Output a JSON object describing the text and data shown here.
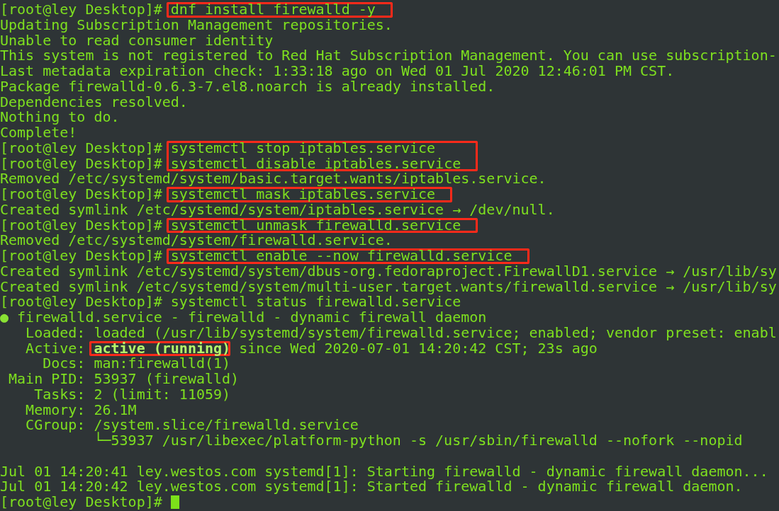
{
  "terminal": {
    "lines": [
      {
        "kind": "prompt",
        "prompt": "[root@ley Desktop]#",
        "command": "dnf install firewalld -y",
        "highlighted": true
      },
      {
        "kind": "output",
        "text": "Updating Subscription Management repositories."
      },
      {
        "kind": "output",
        "text": "Unable to read consumer identity"
      },
      {
        "kind": "output",
        "text": "This system is not registered to Red Hat Subscription Management. You can use subscription-"
      },
      {
        "kind": "output",
        "text": "Last metadata expiration check: 1:33:18 ago on Wed 01 Jul 2020 12:46:01 PM CST."
      },
      {
        "kind": "output",
        "text": "Package firewalld-0.6.3-7.el8.noarch is already installed."
      },
      {
        "kind": "output",
        "text": "Dependencies resolved."
      },
      {
        "kind": "output",
        "text": "Nothing to do."
      },
      {
        "kind": "output",
        "text": "Complete!"
      },
      {
        "kind": "prompt",
        "prompt": "[root@ley Desktop]#",
        "command": "systemctl stop iptables.service",
        "highlighted": true
      },
      {
        "kind": "prompt",
        "prompt": "[root@ley Desktop]#",
        "command": "systemctl disable iptables.service",
        "highlighted": true
      },
      {
        "kind": "output",
        "text": "Removed /etc/systemd/system/basic.target.wants/iptables.service."
      },
      {
        "kind": "prompt",
        "prompt": "[root@ley Desktop]#",
        "command": "systemctl mask iptables.service",
        "highlighted": true
      },
      {
        "kind": "output",
        "text": "Created symlink /etc/systemd/system/iptables.service → /dev/null."
      },
      {
        "kind": "prompt",
        "prompt": "[root@ley Desktop]#",
        "command": "systemctl unmask firewalld.service",
        "highlighted": true
      },
      {
        "kind": "output",
        "text": "Removed /etc/systemd/system/firewalld.service."
      },
      {
        "kind": "prompt",
        "prompt": "[root@ley Desktop]#",
        "command": "systemctl enable --now firewalld.service",
        "highlighted": true
      },
      {
        "kind": "output",
        "text": "Created symlink /etc/systemd/system/dbus-org.fedoraproject.FirewallD1.service → /usr/lib/sy"
      },
      {
        "kind": "output",
        "text": "Created symlink /etc/systemd/system/multi-user.target.wants/firewalld.service → /usr/lib/sy"
      },
      {
        "kind": "prompt",
        "prompt": "[root@ley Desktop]#",
        "command": "systemctl status firewalld.service",
        "highlighted": false
      },
      {
        "kind": "unit",
        "bullet": "●",
        "text": "firewalld.service - firewalld - dynamic firewall daemon"
      },
      {
        "kind": "field",
        "label": "Loaded:",
        "value": "loaded (/usr/lib/systemd/system/firewalld.service; enabled; vendor preset: enabl"
      },
      {
        "kind": "field",
        "label": "Active:",
        "value": "active (running)",
        "bold": true,
        "highlighted": true,
        "rest": "since Wed 2020-07-01 14:20:42 CST; 23s ago"
      },
      {
        "kind": "field",
        "label": "Docs:",
        "value": "man:firewalld(1)"
      },
      {
        "kind": "field",
        "label": "Main PID:",
        "value": "53937 (firewalld)"
      },
      {
        "kind": "field",
        "label": "Tasks:",
        "value": "2 (limit: 11059)"
      },
      {
        "kind": "field",
        "label": "Memory:",
        "value": "26.1M"
      },
      {
        "kind": "field",
        "label": "CGroup:",
        "value": "/system.slice/firewalld.service"
      },
      {
        "kind": "tree",
        "text": "└─53937 /usr/libexec/platform-python -s /usr/sbin/firewalld --nofork --nopid"
      },
      {
        "kind": "blank"
      },
      {
        "kind": "output",
        "text": "Jul 01 14:20:41 ley.westos.com systemd[1]: Starting firewalld - dynamic firewall daemon..."
      },
      {
        "kind": "output",
        "text": "Jul 01 14:20:42 ley.westos.com systemd[1]: Started firewalld - dynamic firewall daemon."
      },
      {
        "kind": "cursor",
        "prompt": "[root@ley Desktop]#"
      }
    ]
  }
}
